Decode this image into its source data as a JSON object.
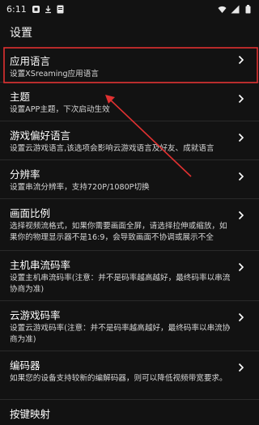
{
  "status_bar": {
    "time": "6:11",
    "icons": [
      "game-icon",
      "download-icon",
      "notification-icon",
      "wifi-icon",
      "signal-icon",
      "battery-icon"
    ]
  },
  "header": {
    "title": "设置"
  },
  "settings": [
    {
      "title": "应用语言",
      "summary": "设置XSreaming应用语言"
    },
    {
      "title": "主题",
      "summary": "设置APP主题，下次启动生效"
    },
    {
      "title": "游戏偏好语言",
      "summary": "设置云游戏语言,该选项会影响云游戏语言及好友、成就语言"
    },
    {
      "title": "分辨率",
      "summary": "设置串流分辨率，支持720P/1080P切换"
    },
    {
      "title": "画面比例",
      "summary": "选择视频流格式，如果你需要画面全屏，请选择拉伸或缩放，如果你的物理显示器不是16:9，会导致画面不协调或展示不全"
    },
    {
      "title": "主机串流码率",
      "summary": "设置主机串流码率(注意：并不是码率越高越好，最终码率以串流协商为准)"
    },
    {
      "title": "云游戏码率",
      "summary": "设置云游戏码率(注意：并不是码率越高越好，最终码率以串流协商为准)"
    },
    {
      "title": "编码器",
      "summary": "如果您的设备支持较新的编解码器，则可以降低视频带宽要求。"
    },
    {
      "title": "按键映射",
      "summary": ""
    }
  ],
  "annotation": {
    "color": "#e03131",
    "highlighted_item": "应用语言"
  }
}
